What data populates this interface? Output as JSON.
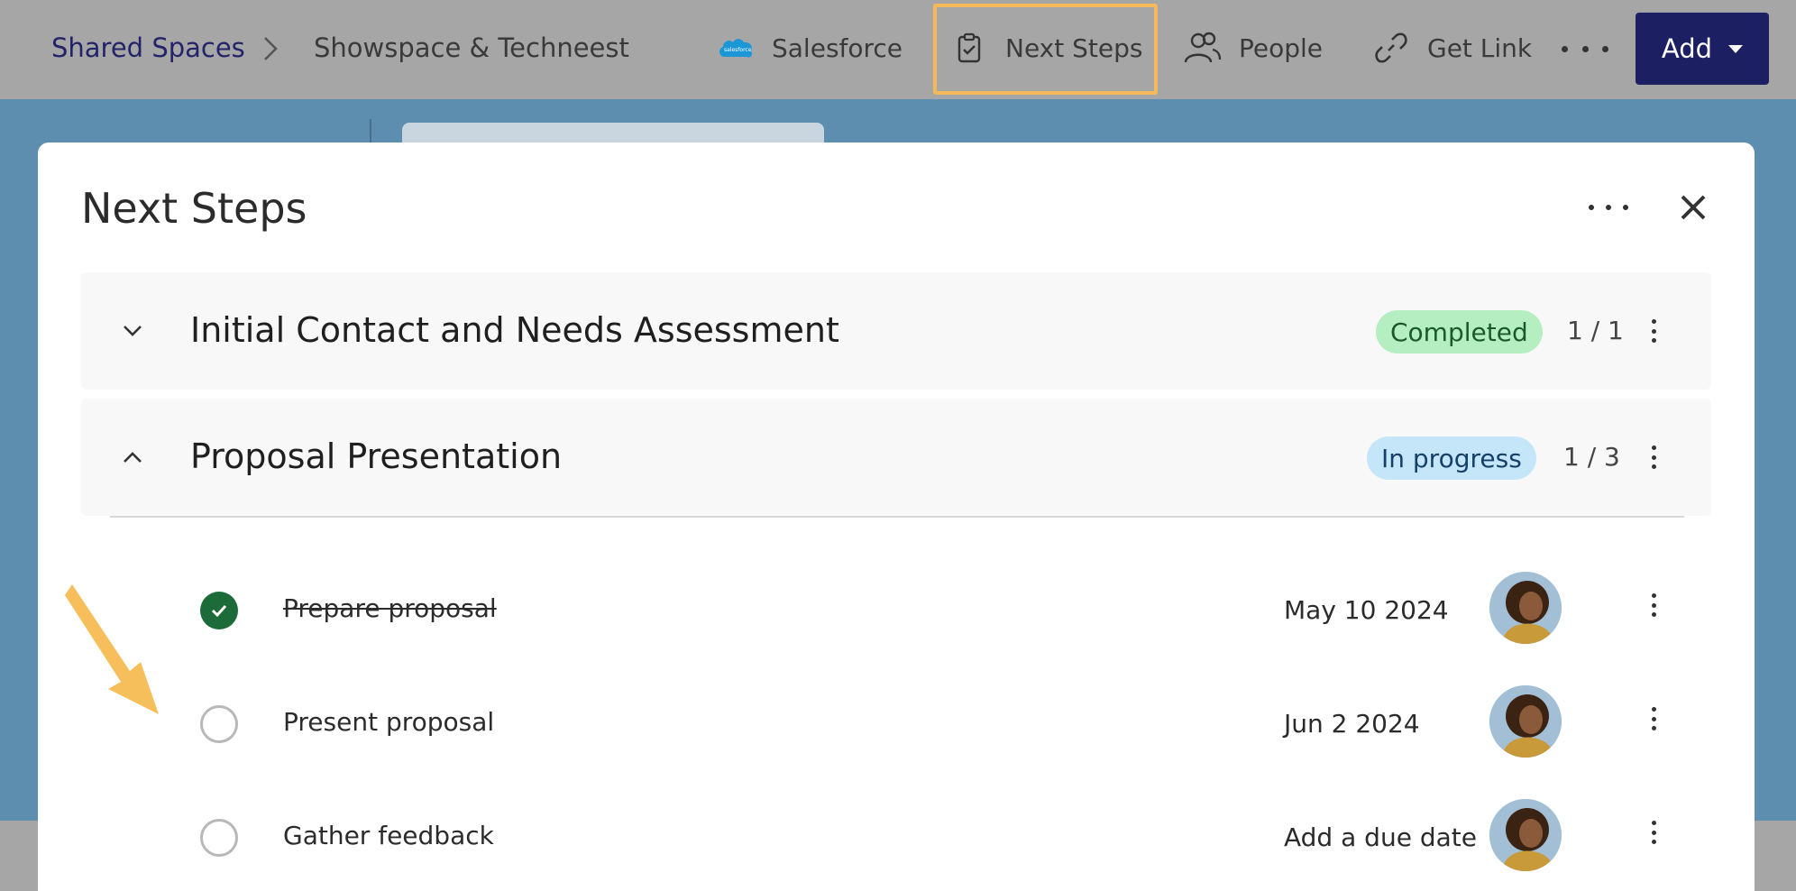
{
  "breadcrumb": {
    "root": "Shared Spaces",
    "current": "Showspace & Techneest"
  },
  "nav": {
    "salesforce": {
      "label": "Salesforce",
      "icon": "salesforce-cloud-icon",
      "icon_text": "salesforce"
    },
    "next_steps": {
      "label": "Next Steps",
      "icon": "clipboard-check-icon"
    },
    "people": {
      "label": "People",
      "icon": "people-icon"
    },
    "get_link": {
      "label": "Get Link",
      "icon": "link-icon"
    },
    "more": {
      "icon": "more-horizontal-icon"
    },
    "add": {
      "label": "Add",
      "icon": "caret-down-icon"
    }
  },
  "colors": {
    "topbar_bg": "#a6a6a6",
    "page_bg": "#5d8eb0",
    "add_button": "#1d1f63",
    "highlight": "#f5b95a",
    "completed_badge": "#b5efc1",
    "in_progress_badge": "#c4e6f8",
    "check_done": "#1e6b3a"
  },
  "modal": {
    "title": "Next Steps",
    "sections": [
      {
        "title": "Initial Contact and Needs Assessment",
        "status": "Completed",
        "count": "1 / 1",
        "expanded": false
      },
      {
        "title": "Proposal Presentation",
        "status": "In progress",
        "count": "1 / 3",
        "expanded": true
      }
    ],
    "tasks": [
      {
        "label": "Prepare proposal",
        "date": "May 10 2024",
        "done": true
      },
      {
        "label": "Present proposal",
        "date": "Jun 2 2024",
        "done": false
      },
      {
        "label": "Gather feedback",
        "date": "Add a due date",
        "done": false
      }
    ]
  }
}
